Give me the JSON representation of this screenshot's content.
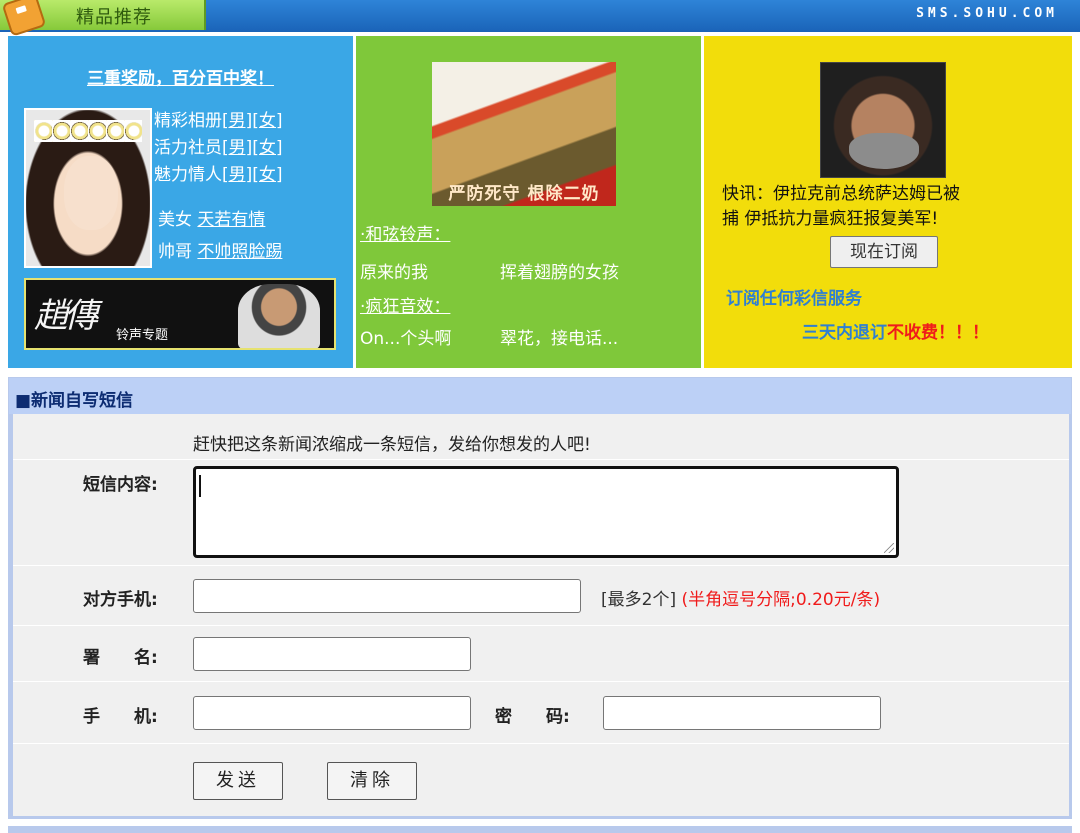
{
  "header": {
    "tab_label": "精品推荐",
    "brand": "SMS.SOHU.COM"
  },
  "promo_left": {
    "headline": "三重奖励，百分百中奖！",
    "headline_bang": "！",
    "rows": [
      {
        "label": "精彩相册",
        "male": "[男]",
        "female": "[女]"
      },
      {
        "label": "活力社员",
        "male": "[男]",
        "female": "[女]"
      },
      {
        "label": "魅力情人",
        "male": "[男]",
        "female": "[女]"
      }
    ],
    "pair1_prefix": "美女 ",
    "pair1_link": "天若有情",
    "pair2_prefix": "帅哥 ",
    "pair2_link": "不帅照脸踢",
    "banner_calligraphy": "趙傳",
    "banner_sub": "铃声专题"
  },
  "promo_middle": {
    "poster_slogan": "严防死守 根除二奶",
    "ring_title": "·和弦铃声：",
    "songs_row1": [
      "原来的我",
      "挥着翅膀的女孩"
    ],
    "fx_title": "·疯狂音效：",
    "songs_row2": [
      "On...个头啊",
      "翠花，接电话..."
    ]
  },
  "promo_right": {
    "news_line1": "快讯：伊拉克前总统萨达姆已被",
    "news_line2": "捕 伊抵抗力量疯狂报复美军!",
    "subscribe_button": "现在订阅",
    "slogan1": "订阅任何彩信服务",
    "slogan2_prefix": "三天内退订",
    "slogan2_red": "不收费！！！"
  },
  "form": {
    "title": "■新闻自写短信",
    "hint": "赶快把这条新闻浓缩成一条短信，发给你想发的人吧!",
    "content_label": "短信内容:",
    "content_value": "",
    "phone_label": "对方手机:",
    "phone_value": "",
    "phone_note": "[最多2个]",
    "phone_note_red": "(半角逗号分隔;0.20元/条)",
    "sign_label": "署　　名:",
    "sign_value": "",
    "mobile_label": "手　　机:",
    "mobile_value": "",
    "password_label": "密　　码:",
    "password_value": "",
    "send_button": "发送",
    "clear_button": "清除"
  }
}
